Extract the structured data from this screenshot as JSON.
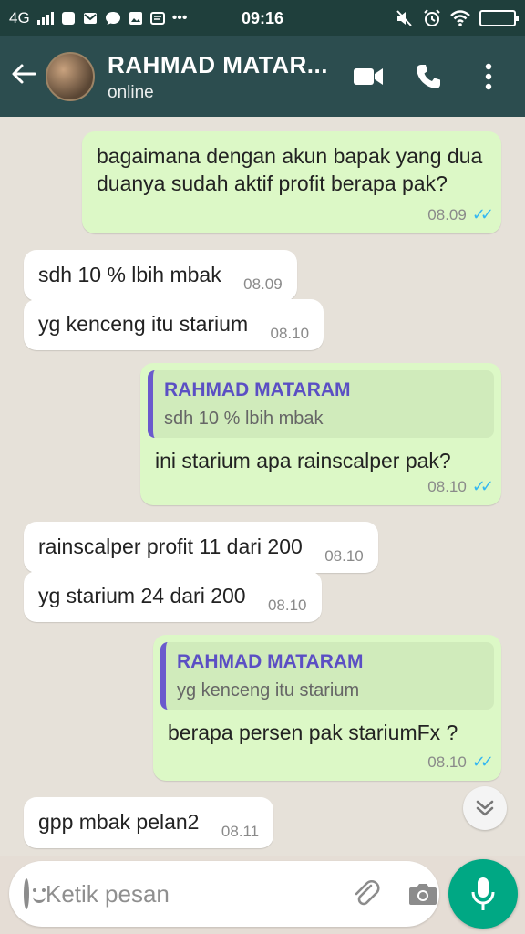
{
  "status_bar": {
    "network": "4G",
    "time": "09:16"
  },
  "header": {
    "contact_name": "RAHMAD MATAR...",
    "contact_status": "online"
  },
  "messages": [
    {
      "dir": "out",
      "text": "bagaimana dengan akun bapak yang dua duanya sudah aktif profit berapa pak?",
      "time": "08.09"
    },
    {
      "dir": "in",
      "text": "sdh 10 % lbih mbak",
      "time": "08.09"
    },
    {
      "dir": "in",
      "text": "yg kenceng itu starium",
      "time": "08.10"
    },
    {
      "dir": "out",
      "quote_name": "RAHMAD MATARAM",
      "quote_text": "sdh 10 % lbih mbak",
      "text": "ini starium apa rainscalper pak?",
      "time": "08.10"
    },
    {
      "dir": "in",
      "text": "rainscalper profit 11 dari 200",
      "time": "08.10"
    },
    {
      "dir": "in",
      "text": "yg starium 24 dari 200",
      "time": "08.10"
    },
    {
      "dir": "out",
      "quote_name": "RAHMAD MATARAM",
      "quote_text": "yg kenceng itu starium",
      "text": "berapa persen pak stariumFx ?",
      "time": "08.10"
    },
    {
      "dir": "in",
      "text": "gpp mbak pelan2",
      "time": "08.11"
    }
  ],
  "input": {
    "placeholder": "Ketik pesan"
  },
  "colors": {
    "header_bg": "#2c4d4f",
    "out_bubble": "#dcf8c6",
    "in_bubble": "#ffffff",
    "mic_button": "#00a884",
    "read_ticks": "#34b7f1",
    "quote_accent": "#6a5acd"
  },
  "icons": [
    "back-arrow-icon",
    "video-call-icon",
    "phone-icon",
    "more-vert-icon",
    "scroll-down-icon",
    "emoji-icon",
    "attach-icon",
    "camera-icon",
    "mic-icon"
  ]
}
